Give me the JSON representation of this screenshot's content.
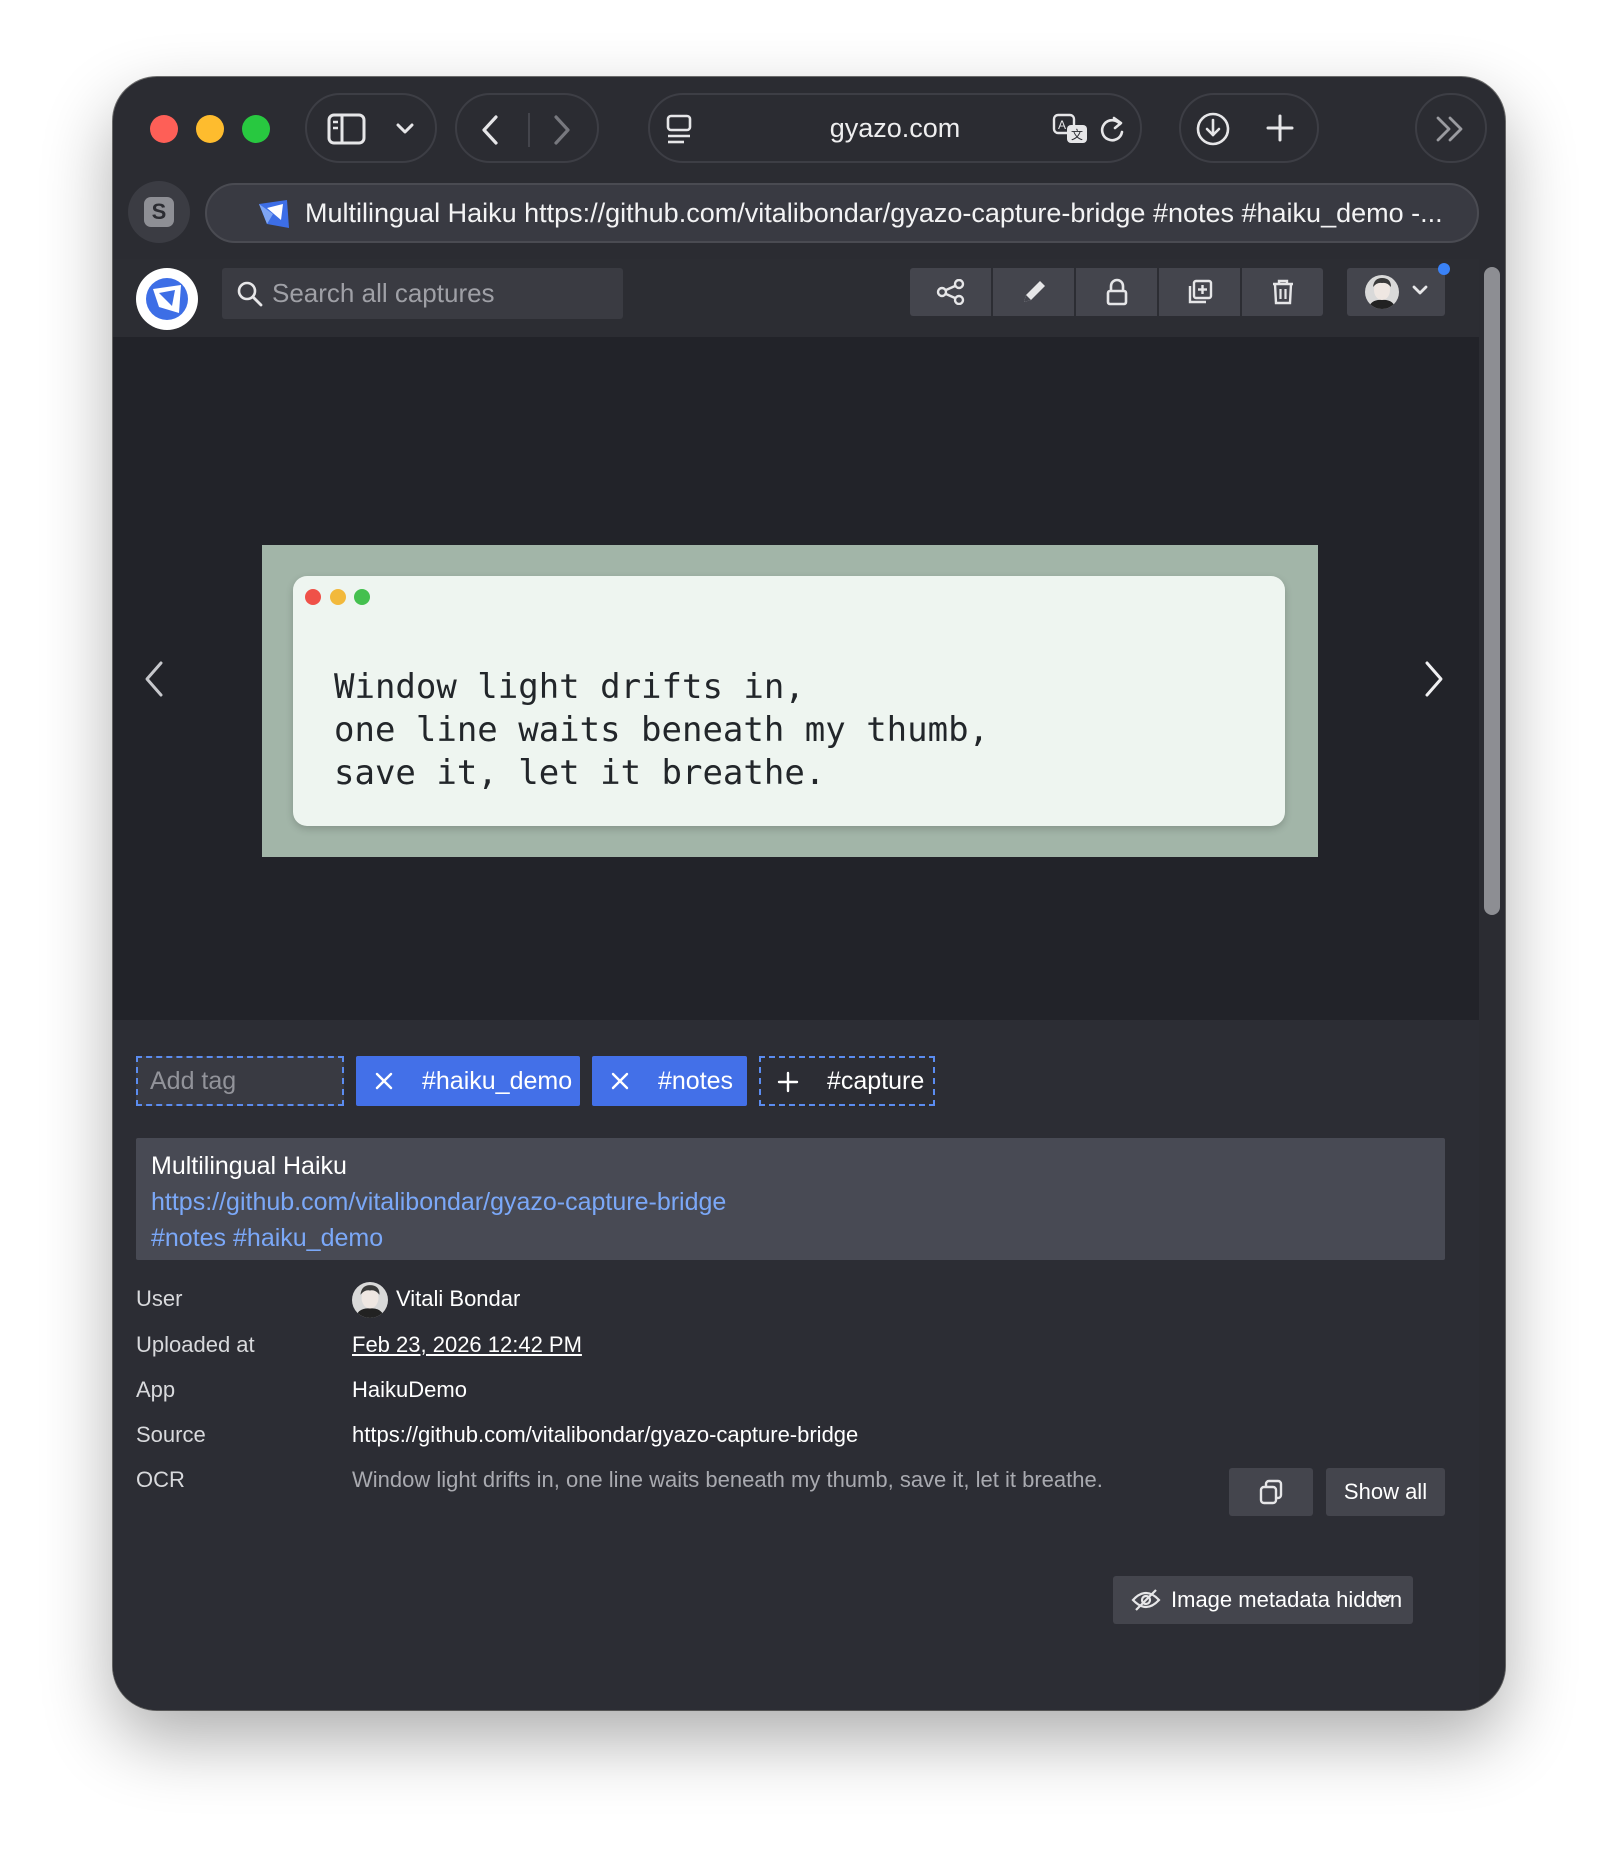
{
  "browser": {
    "address": "gyazo.com",
    "tab_title": "Multilingual Haiku https://github.com/vitalibondar/gyazo-capture-bridge #notes #haiku_demo -...",
    "profile_letter": "S"
  },
  "header": {
    "search_placeholder": "Search all captures"
  },
  "capture": {
    "haiku_lines": [
      "Window light drifts in,",
      "one line waits beneath my thumb,",
      "save it, let it breathe."
    ]
  },
  "tags": {
    "input_placeholder": "Add tag",
    "applied": [
      "#haiku_demo",
      "#notes"
    ],
    "suggested": "#capture"
  },
  "description": {
    "title": "Multilingual Haiku",
    "link": "https://github.com/vitalibondar/gyazo-capture-bridge",
    "hashtags": "#notes #haiku_demo"
  },
  "metadata": {
    "user_label": "User",
    "user_value": "Vitali Bondar",
    "uploaded_label": "Uploaded at",
    "uploaded_value": "Feb 23, 2026 12:42 PM",
    "app_label": "App",
    "app_value": "HaikuDemo",
    "source_label": "Source",
    "source_value": "https://github.com/vitalibondar/gyazo-capture-bridge",
    "ocr_label": "OCR",
    "ocr_value": "Window light drifts in, one line waits beneath my thumb, save it, let it breathe.",
    "show_all_label": "Show all",
    "hidden_label": "Image metadata hidden"
  },
  "colors": {
    "accent": "#4370e8",
    "link": "#7ba8f8",
    "capture_bg": "#a2b5a8",
    "card_bg": "#eef5f0"
  }
}
